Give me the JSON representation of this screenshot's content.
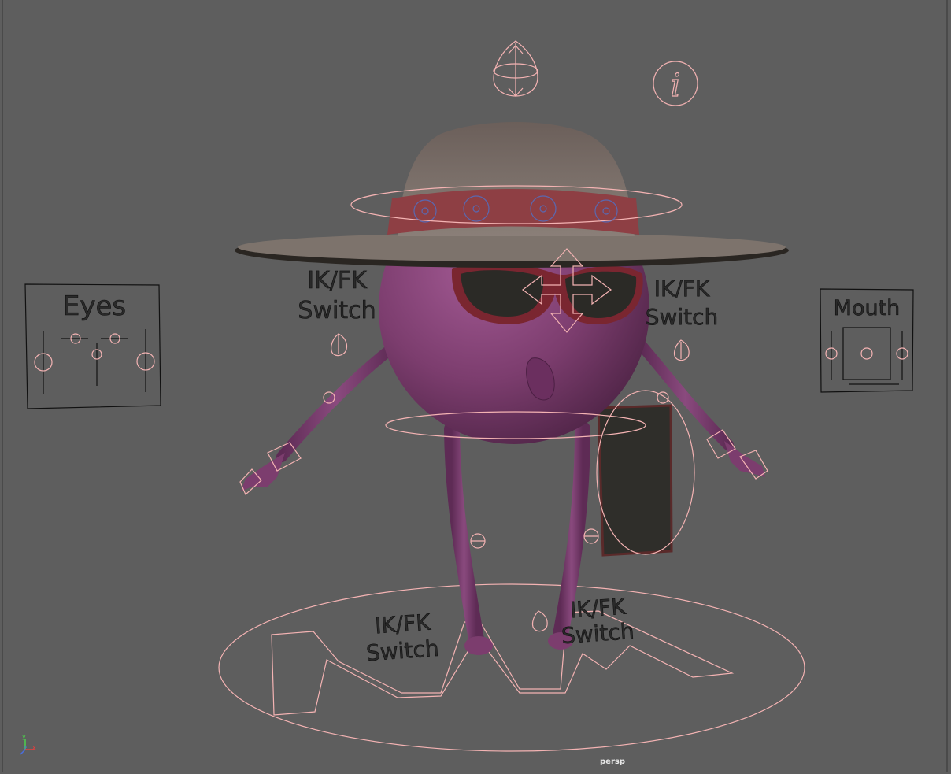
{
  "viewport": {
    "camera_name": "persp",
    "axis_labels": [
      "y",
      "z",
      "x"
    ],
    "colors": {
      "background": "#5e5e5e",
      "controller": "#f4b3b3",
      "body": "#7a3a6c",
      "hat": "#6c625d",
      "hat_band": "#8e3f44",
      "lenses": "#2b2a26"
    }
  },
  "controls": {
    "eyes_label": "Eyes",
    "mouth_label": "Mouth",
    "ikfk_left_arm": [
      "IK/FK",
      "Switch"
    ],
    "ikfk_right_arm": [
      "IK/FK",
      "Switch"
    ],
    "ikfk_left_leg": [
      "IK/FK",
      "Switch"
    ],
    "ikfk_right_leg": [
      "IK/FK",
      "Switch"
    ],
    "info_symbol": "i"
  }
}
